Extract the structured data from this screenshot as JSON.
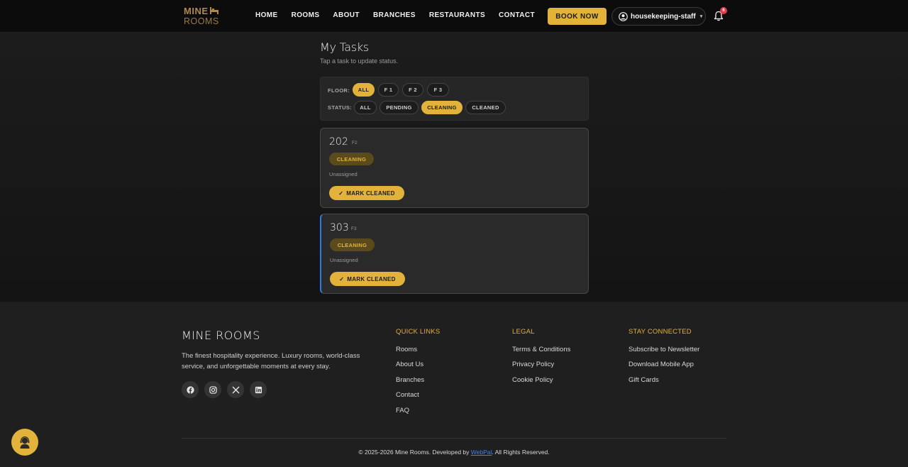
{
  "brand": {
    "logo_line1": "MINE",
    "logo_line2": "ROOMS"
  },
  "nav": {
    "links": [
      "HOME",
      "ROOMS",
      "ABOUT",
      "BRANCHES",
      "RESTAURANTS",
      "CONTACT"
    ],
    "book_label": "BOOK NOW",
    "user": "housekeeping-staff",
    "notification_count": "6"
  },
  "page": {
    "title": "My Tasks",
    "subtitle": "Tap a task to update status."
  },
  "filters": {
    "floor_label": "FLOOR:",
    "floor_options": [
      "ALL",
      "F 1",
      "F 2",
      "F 3"
    ],
    "floor_selected": "ALL",
    "status_label": "STATUS:",
    "status_options": [
      "ALL",
      "PENDING",
      "CLEANING",
      "CLEANED"
    ],
    "status_selected": "CLEANING"
  },
  "tasks": [
    {
      "room": "202",
      "floor": "F2",
      "status": "CLEANING",
      "assignee": "Unassigned",
      "action": "MARK CLEANED"
    },
    {
      "room": "303",
      "floor": "F3",
      "status": "CLEANING",
      "assignee": "Unassigned",
      "action": "MARK CLEANED"
    }
  ],
  "footer": {
    "brand": "MINE ROOMS",
    "description": "The finest hospitality experience. Luxury rooms, world-class service, and unforgettable moments at every stay.",
    "quick_links": {
      "heading": "QUICK LINKS",
      "items": [
        "Rooms",
        "About Us",
        "Branches",
        "Contact",
        "FAQ"
      ]
    },
    "legal": {
      "heading": "LEGAL",
      "items": [
        "Terms & Conditions",
        "Privacy Policy",
        "Cookie Policy"
      ]
    },
    "stay_connected": {
      "heading": "STAY CONNECTED",
      "items": [
        "Subscribe to Newsletter",
        "Download Mobile App",
        "Gift Cards"
      ]
    },
    "copyright_prefix": "© 2025-2026 Mine Rooms. Developed by ",
    "developer": "WebPal",
    "copyright_suffix": ". All Rights Reserved."
  },
  "colors": {
    "accent": "#e2b23b",
    "highlight_border": "#2e7be8",
    "badge": "#e23b4a"
  },
  "icons": [
    "bed-icon",
    "user-circle-icon",
    "bell-icon",
    "check-icon",
    "facebook-icon",
    "instagram-icon",
    "x-icon",
    "linkedin-icon",
    "support-agent-icon"
  ]
}
